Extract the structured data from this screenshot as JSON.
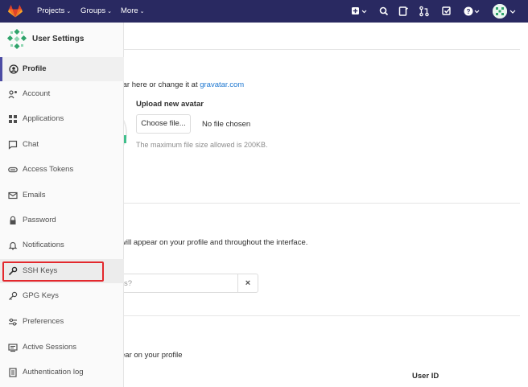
{
  "topbar": {
    "nav": [
      {
        "label": "Projects"
      },
      {
        "label": "Groups"
      },
      {
        "label": "More"
      }
    ],
    "icons": [
      "plus-square-icon",
      "search-icon",
      "issues-icon",
      "merge-request-icon",
      "todo-icon",
      "help-icon",
      "user-avatar"
    ]
  },
  "sidebar": {
    "title": "User Settings",
    "items": [
      {
        "label": "Profile",
        "icon": "profile-icon",
        "active": true
      },
      {
        "label": "Account",
        "icon": "account-icon"
      },
      {
        "label": "Applications",
        "icon": "applications-icon"
      },
      {
        "label": "Chat",
        "icon": "chat-icon"
      },
      {
        "label": "Access Tokens",
        "icon": "token-icon"
      },
      {
        "label": "Emails",
        "icon": "email-icon"
      },
      {
        "label": "Password",
        "icon": "lock-icon"
      },
      {
        "label": "Notifications",
        "icon": "bell-icon"
      },
      {
        "label": "SSH Keys",
        "icon": "key-icon",
        "highlighted": true
      },
      {
        "label": "GPG Keys",
        "icon": "gpg-key-icon"
      },
      {
        "label": "Preferences",
        "icon": "preferences-icon"
      },
      {
        "label": "Active Sessions",
        "icon": "sessions-icon"
      },
      {
        "label": "Authentication log",
        "icon": "log-icon"
      }
    ]
  },
  "main": {
    "avatar": {
      "gravatar_prefix": "tar here or change it at ",
      "gravatar_link": "gravatar.com",
      "upload_heading": "Upload new avatar",
      "choose_file": "Choose file...",
      "no_file": "No file chosen",
      "max_size": "The maximum file size allowed is 200KB."
    },
    "status": {
      "description": "will appear on your profile and throughout the interface.",
      "placeholder": "s?",
      "clear": "×"
    },
    "main_settings": {
      "description": "ear on your profile",
      "user_id_label": "User ID"
    }
  },
  "colors": {
    "navbar": "#292961",
    "accent": "#4b4ba3",
    "link": "#1f78d1",
    "highlight": "#e3282d"
  }
}
